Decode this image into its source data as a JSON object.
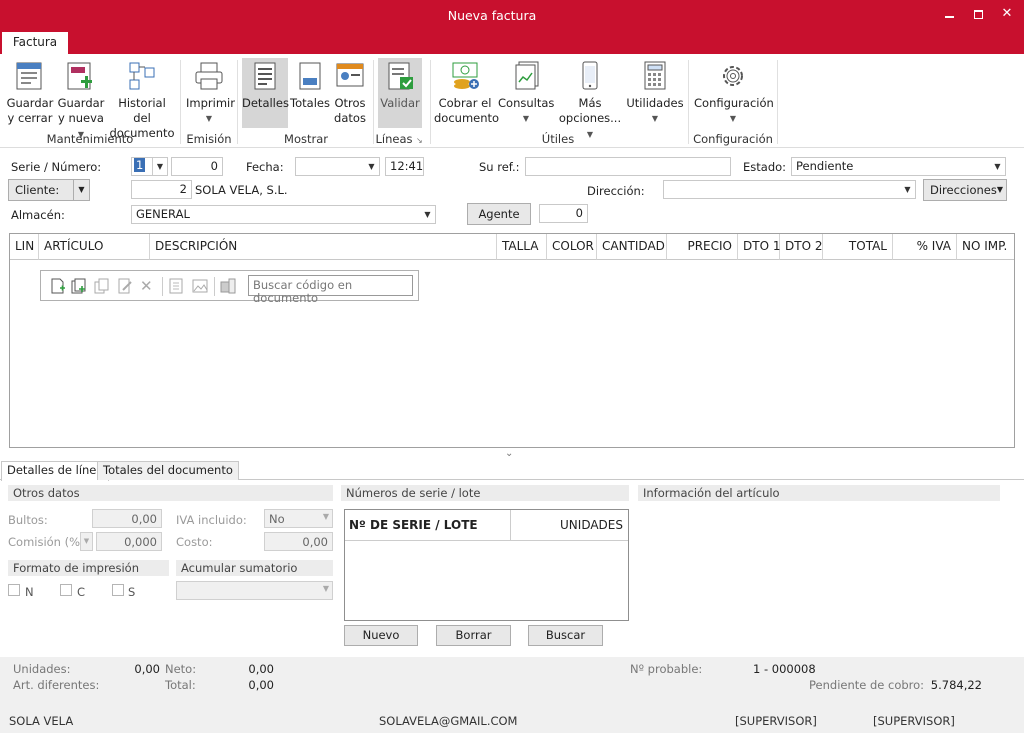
{
  "window": {
    "title": "Nueva factura",
    "controls": {
      "minimize": "minimize-icon",
      "maximize": "maximize-icon",
      "close": "close-icon"
    },
    "accent_color": "#c8102e"
  },
  "ribbon": {
    "tab": "Factura",
    "buttons": {
      "guardar_cerrar": [
        "Guardar",
        "y cerrar"
      ],
      "guardar_nueva": [
        "Guardar",
        "y nueva"
      ],
      "historial": [
        "Historial del",
        "documento"
      ],
      "imprimir": "Imprimir",
      "detalles": "Detalles",
      "totales": "Totales",
      "otros": [
        "Otros",
        "datos"
      ],
      "validar": "Validar",
      "cobrar": [
        "Cobrar el",
        "documento"
      ],
      "consultas": "Consultas",
      "mas": [
        "Más",
        "opciones..."
      ],
      "utilidades": "Utilidades",
      "configuracion": "Configuración"
    },
    "groups": {
      "mantenimiento": "Mantenimiento",
      "emision": "Emisión",
      "mostrar": "Mostrar",
      "lineas": "Líneas",
      "utiles": "Útiles",
      "configuracion": "Configuración"
    }
  },
  "header": {
    "serie_label": "Serie / Número:",
    "serie_value": "1",
    "numero_value": "0",
    "fecha_label": "Fecha:",
    "fecha_value": "",
    "hora_value": "12:41",
    "suref_label": "Su ref.:",
    "suref_value": "",
    "estado_label": "Estado:",
    "estado_value": "Pendiente",
    "cliente_label": "Cliente:",
    "cliente_code": "2",
    "cliente_name": "SOLA VELA, S.L.",
    "direccion_label": "Dirección:",
    "direccion_value": "",
    "direcciones_button": "Direcciones",
    "almacen_label": "Almacén:",
    "almacen_value": "GENERAL",
    "agente_button": "Agente",
    "agente_value": "0"
  },
  "grid": {
    "columns": [
      "LIN",
      "ARTÍCULO",
      "DESCRIPCIÓN",
      "TALLA",
      "COLOR",
      "CANTIDAD",
      "PRECIO",
      "DTO 1",
      "DTO 2",
      "TOTAL",
      "% IVA",
      "NO IMP."
    ],
    "search_placeholder": "Buscar código en documento"
  },
  "bottom_tabs": [
    "Detalles de línea",
    "Totales del documento"
  ],
  "otros_datos": {
    "title": "Otros datos",
    "bultos_label": "Bultos:",
    "bultos_value": "0,00",
    "iva_label": "IVA incluido:",
    "iva_value": "No",
    "comision_label": "Comisión (%)",
    "comision_value": "0,000",
    "coste_label": "Costo:",
    "coste_value": "0,00",
    "formato_title": "Formato de impresión",
    "formato_options": [
      "N",
      "C",
      "S"
    ],
    "acumular_title": "Acumular sumatorio",
    "acumular_value": ""
  },
  "serie_lote": {
    "title": "Números de serie / lote",
    "col1": "Nº DE SERIE / LOTE",
    "col2": "UNIDADES",
    "buttons": [
      "Nuevo",
      "Borrar",
      "Buscar"
    ]
  },
  "info_articulo": {
    "title": "Información del artículo"
  },
  "status": {
    "unidades_label": "Unidades:",
    "unidades_value": "0,00",
    "art_label": "Art. diferentes:",
    "neto_label": "Neto:",
    "neto_value": "0,00",
    "total_label": "Total:",
    "total_value": "0,00",
    "probable_label": "Nº probable:",
    "probable_value": "1 - 000008",
    "pendiente_label": "Pendiente de cobro:",
    "pendiente_value": "5.784,22"
  },
  "footer": {
    "company": "SOLA VELA",
    "email": "SOLAVELA@GMAIL.COM",
    "user1": "[SUPERVISOR]",
    "user2": "[SUPERVISOR]"
  }
}
